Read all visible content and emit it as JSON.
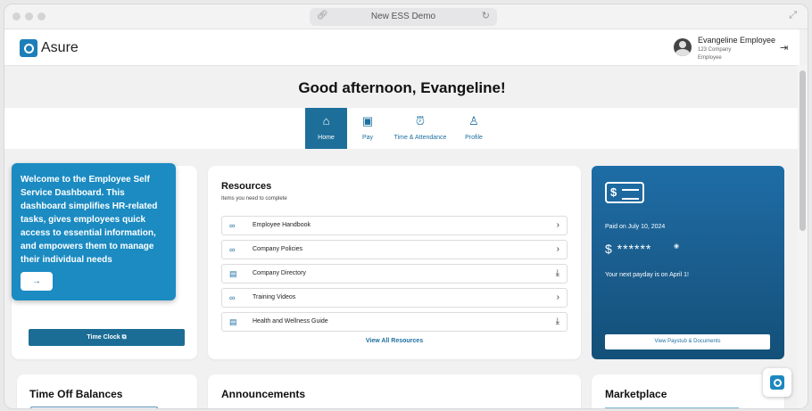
{
  "browser": {
    "url_title": "New ESS Demo",
    "link_icon": "link-icon",
    "reload_icon": "reload-icon",
    "expand_icon": "expand-icon"
  },
  "header": {
    "logo_text": "Asure",
    "user": {
      "name": "Evangeline Employee",
      "company": "123 Company",
      "role": "Employee"
    },
    "logout_icon": "logout-icon"
  },
  "greeting": "Good afternoon, Evangeline!",
  "nav": [
    {
      "label": "Home",
      "icon": "home-icon",
      "active": true
    },
    {
      "label": "Pay",
      "icon": "money-icon",
      "active": false
    },
    {
      "label": "Time & Attendance",
      "icon": "alarm-clock-icon",
      "active": false
    },
    {
      "label": "Profile",
      "icon": "person-icon",
      "active": false
    }
  ],
  "welcome": {
    "text": "Welcome to the Employee Self Service Dashboard. This dashboard simplifies HR-related tasks, gives employees quick access to essential information, and empowers them to manage their individual needs",
    "button": "→"
  },
  "time_clock": {
    "label": "Time Clock ⧉"
  },
  "resources": {
    "title": "Resources",
    "subtitle": "Items you need to complete",
    "items": [
      {
        "label": "Employee Handbook",
        "icon": "link-icon",
        "end": "›"
      },
      {
        "label": "Company Policies",
        "icon": "link-icon",
        "end": "›"
      },
      {
        "label": "Company Directory",
        "icon": "document-icon",
        "end": "⤓"
      },
      {
        "label": "Training Videos",
        "icon": "link-icon",
        "end": "›"
      },
      {
        "label": "Health and Wellness Guide",
        "icon": "document-icon",
        "end": "⤓"
      }
    ],
    "view_all": "View All Resources"
  },
  "pay": {
    "paid_on": "Paid on July 10, 2024",
    "amount": "$ ******",
    "next_payday": "Your next payday is on April 1!",
    "button": "View Paystub & Documents",
    "icon": "dollar-bill-icon"
  },
  "sections": {
    "time_off": "Time Off Balances",
    "announcements": "Announcements",
    "marketplace": "Marketplace"
  }
}
